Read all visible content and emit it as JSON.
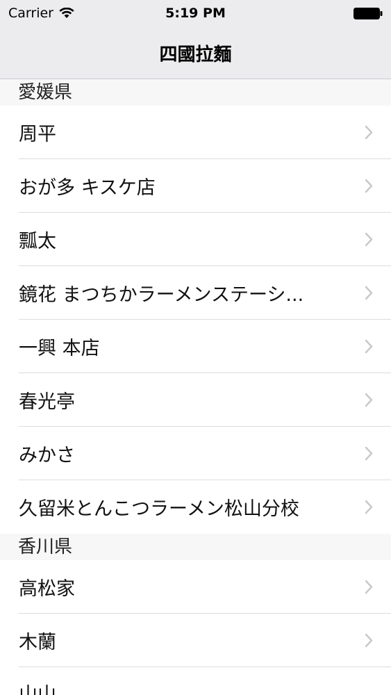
{
  "status_bar": {
    "carrier": "Carrier",
    "time": "5:19 PM",
    "wifi_icon": "wifi-icon",
    "battery_icon": "battery-icon"
  },
  "nav": {
    "title": "四國拉麵"
  },
  "sections": [
    {
      "header": "愛媛県",
      "items": [
        "周平",
        "おが多 キスケ店",
        "瓢太",
        "鏡花 まつちかラーメンステーシ...",
        "一興 本店",
        "春光亭",
        "みかさ",
        "久留米とんこつラーメン松山分校"
      ]
    },
    {
      "header": "香川県",
      "items": [
        "高松家",
        "木蘭",
        "山山"
      ]
    }
  ],
  "colors": {
    "nav_background": "#ececee",
    "section_background": "#f7f7f7",
    "chevron": "#c7c7cc"
  }
}
